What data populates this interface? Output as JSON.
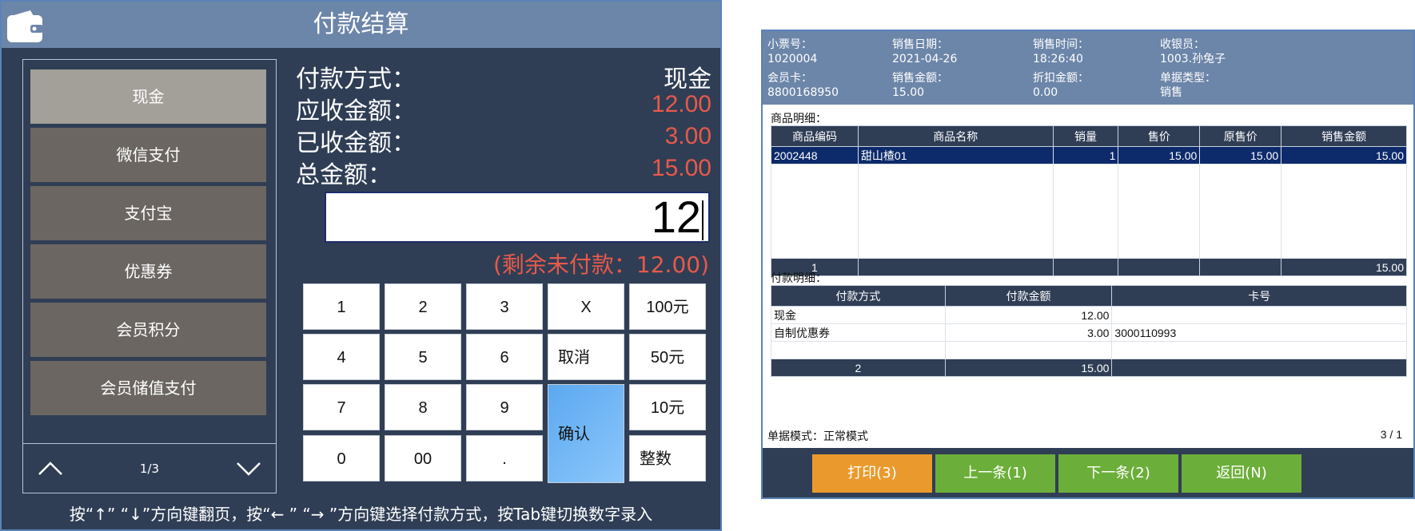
{
  "payment": {
    "title": "付款结算",
    "methods": [
      "现金",
      "微信支付",
      "支付宝",
      "优惠券",
      "会员积分",
      "会员储值支付"
    ],
    "active_method_index": 0,
    "page_indicator": "1/3",
    "info": [
      {
        "label": "付款方式：",
        "value": "现金"
      },
      {
        "label": "应收金额：",
        "value": "12.00"
      },
      {
        "label": "已收金额：",
        "value": "3.00"
      },
      {
        "label": "总金额：",
        "value": "15.00"
      }
    ],
    "input_value": "12",
    "remaining": "(剩余未付款：12.00)",
    "keys": {
      "k1": "1",
      "k2": "2",
      "k3": "3",
      "kx": "X",
      "k100": "100元",
      "k4": "4",
      "k5": "5",
      "k6": "6",
      "kcancel": "取消",
      "k50": "50元",
      "k7": "7",
      "k8": "8",
      "k9": "9",
      "kconfirm": "确认",
      "k10": "10元",
      "k0": "0",
      "k00": "00",
      "kdot": ".",
      "kint": "整数"
    },
    "hint": "按“↑” “↓”方向键翻页，按“← ” “→ ”方向键选择付款方式，按Tab键切换数字录入"
  },
  "detail": {
    "header": {
      "ticket_label": "小票号：",
      "ticket_value": "1020004",
      "date_label": "销售日期：",
      "date_value": "2021-04-26",
      "time_label": "销售时间：",
      "time_value": "18:26:40",
      "cashier_label": "收银员：",
      "cashier_value": "1003.孙兔子",
      "member_label": "会员卡：",
      "member_value": "8800168950",
      "sale_amount_label": "销售金额：",
      "sale_amount_value": "15.00",
      "discount_label": "折扣金额：",
      "discount_value": "0.00",
      "type_label": "单据类型：",
      "type_value": "销售"
    },
    "goods_section": "商品明细：",
    "goods_columns": [
      "商品编码",
      "商品名称",
      "销量",
      "售价",
      "原售价",
      "销售金额"
    ],
    "goods_row": {
      "code": "2002448",
      "name": "甜山楂01",
      "qty": "1",
      "price": "15.00",
      "orig_price": "15.00",
      "amount": "15.00"
    },
    "goods_footer": {
      "count": "1",
      "total": "15.00"
    },
    "pay_section": "付款明细：",
    "pay_columns": [
      "付款方式",
      "付款金额",
      "卡号"
    ],
    "pay_rows": [
      {
        "method": "现金",
        "amount": "12.00",
        "card": ""
      },
      {
        "method": "自制优惠券",
        "amount": "3.00",
        "card": "3000110993"
      }
    ],
    "pay_footer": {
      "count": "2",
      "total": "15.00"
    },
    "mode": "单据模式：正常模式",
    "page": "3 / 1",
    "buttons": {
      "print": "打印(3)",
      "prev": "上一条(1)",
      "next": "下一条(2)",
      "back": "返回(N)"
    },
    "colors": {
      "print": "#ea9a2c",
      "nav": "#6cae3a"
    }
  }
}
